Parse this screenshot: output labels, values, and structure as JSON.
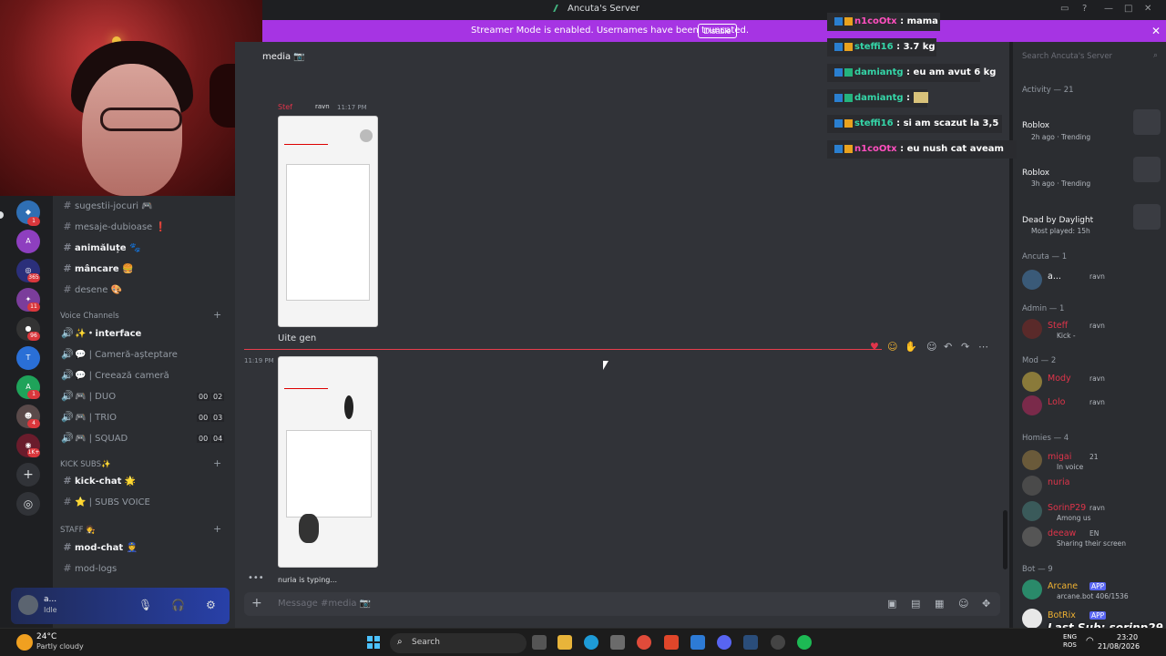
{
  "titlebar": {
    "title": "Ancuta's Server"
  },
  "banner": {
    "text": "Streamer Mode is enabled. Usernames have been truncated.",
    "button": "Disable",
    "color": "#a634e3"
  },
  "rail": {
    "badges": [
      "1",
      "",
      "365",
      "11",
      "96",
      "",
      "1",
      "4",
      "1K+"
    ]
  },
  "channels": {
    "text_items": [
      {
        "label": "sugestii-jocuri 🎮",
        "bright": false
      },
      {
        "label": "mesaje-dubioase ❗",
        "bright": false
      },
      {
        "label": "animăluțe 🐾",
        "bright": true
      },
      {
        "label": "mâncare 🍔",
        "bright": true
      },
      {
        "label": "desene 🎨",
        "bright": false
      }
    ],
    "voice_category": "Voice Channels",
    "voice_items": [
      {
        "label": "✨・interface",
        "bright": true
      },
      {
        "label": "💬 | Cameră-așteptare",
        "bright": false
      },
      {
        "label": "💬 | Creează cameră",
        "bright": false
      },
      {
        "label": "🎮 | DUO",
        "bright": false,
        "count1": "00",
        "count2": "02"
      },
      {
        "label": "🎮 | TRIO",
        "bright": false,
        "count1": "00",
        "count2": "03"
      },
      {
        "label": "🎮 | SQUAD",
        "bright": false,
        "count1": "00",
        "count2": "04"
      }
    ],
    "kick_category": "KICK SUBS✨",
    "kick_items": [
      {
        "label": "kick-chat 🌟",
        "bright": true
      },
      {
        "label": "⭐ | SUBS VOICE",
        "bright": false
      }
    ],
    "staff_category": "STAFF 🧑‍⚖️",
    "staff_items": [
      {
        "label": "mod-chat 👮",
        "bright": true
      },
      {
        "label": "mod-logs",
        "bright": false
      }
    ]
  },
  "userbar": {
    "name": "a...",
    "status": "Idle"
  },
  "chat": {
    "header": "media 📷",
    "message1": {
      "author": "Stef",
      "tag": "ravn",
      "time": "11:17 PM"
    },
    "message_text": "Uite gen",
    "message2": {
      "time": "11:19 PM"
    },
    "typing": "nuria is typing...",
    "composer_placeholder": "Message #media 📷"
  },
  "overlay": {
    "messages": [
      {
        "user": "n1coOtx",
        "text": "mama",
        "color": "#ff4fbf"
      },
      {
        "user": "steffi16",
        "text": "3.7 kg",
        "color": "#35d6a8"
      },
      {
        "user": "damiantg",
        "text": "eu am avut 6 kg",
        "color": "#35d6a8"
      },
      {
        "user": "damiantg",
        "text": "",
        "color": "#35d6a8"
      },
      {
        "user": "steffi16",
        "text": "si am scazut la 3,5",
        "color": "#35d6a8"
      },
      {
        "user": "n1coOtx",
        "text": "eu nush cat aveam",
        "color": "#ff4fbf"
      }
    ]
  },
  "members": {
    "search_placeholder": "Search Ancuta's Server",
    "activity_title": "Activity — 21",
    "activities": [
      {
        "title": "Roblox",
        "sub": "2h ago · Trending"
      },
      {
        "title": "Roblox",
        "sub": "3h ago · Trending"
      },
      {
        "title": "Dead by Daylight",
        "sub": "Most played: 15h"
      }
    ],
    "sections": {
      "ancuta": "Ancuta — 1",
      "admin": "Admin — 1",
      "mod": "Mod — 2",
      "homies": "Homies — 4",
      "bot": "Bot — 9"
    },
    "people": [
      {
        "name": "a...",
        "tag": "ravn",
        "sub": "",
        "color": "#f2f3f5"
      },
      {
        "name": "Steff",
        "tag": "ravn",
        "sub": "Kick -",
        "color": "#e0344a"
      },
      {
        "name": "Mody",
        "tag": "ravn",
        "sub": "",
        "color": "#e0344a"
      },
      {
        "name": "Lolo",
        "tag": "ravn",
        "sub": "",
        "color": "#e0344a"
      },
      {
        "name": "migai",
        "tag": "21",
        "sub": "In voice",
        "color": "#e0344a"
      },
      {
        "name": "nuria",
        "tag": "",
        "sub": "",
        "color": "#e0344a"
      },
      {
        "name": "SorinP29",
        "tag": "ravn",
        "sub": "Among us",
        "color": "#e0344a"
      },
      {
        "name": "deeaw",
        "tag": "EN",
        "sub": "Sharing their screen",
        "color": "#e0344a"
      },
      {
        "name": "Arcane",
        "tag": "APP",
        "sub": "arcane.bot 406/1536",
        "color": "#f0b232"
      },
      {
        "name": "BotRix",
        "tag": "APP",
        "sub": "",
        "color": "#f0b232"
      }
    ],
    "last_sub": "Last Sub: sorinp29"
  },
  "taskbar": {
    "weather_temp": "24°C",
    "weather_desc": "Partly cloudy",
    "search": "Search",
    "lang1": "ENG",
    "lang2": "ROS",
    "time": "23:20",
    "date": "21/08/2026"
  }
}
